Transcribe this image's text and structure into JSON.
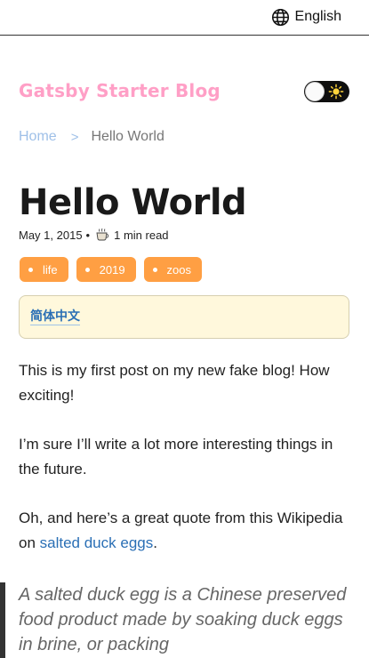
{
  "header": {
    "language_label": "English"
  },
  "site": {
    "brand": "Gatsby Starter Blog"
  },
  "breadcrumb": {
    "home": "Home",
    "separator": ">",
    "current": "Hello World"
  },
  "post": {
    "title": "Hello World",
    "date": "May 1, 2015",
    "meta_separator": "•",
    "read_time": "1 min read",
    "tags": [
      "life",
      "2019",
      "zoos"
    ],
    "translation_link": "简体中文",
    "paragraphs": [
      "This is my first post on my new fake blog! How exciting!",
      "I’m sure I’ll write a lot more interesting things in the future."
    ],
    "quote_intro": "Oh, and here’s a great quote from this Wikipedia on ",
    "quote_link": "salted duck eggs",
    "quote_intro_end": ".",
    "blockquote": "A salted duck egg is a Chinese preserved food product made by soaking duck eggs in brine, or packing"
  },
  "colors": {
    "brand": "#ff9fc6",
    "tag": "#ff9f43",
    "link": "#2a6fb5",
    "translation_bg": "#fff8dc"
  },
  "icons": {
    "language": "globe-icon",
    "theme": "sun-icon",
    "read_time": "coffee-cup-icon"
  }
}
